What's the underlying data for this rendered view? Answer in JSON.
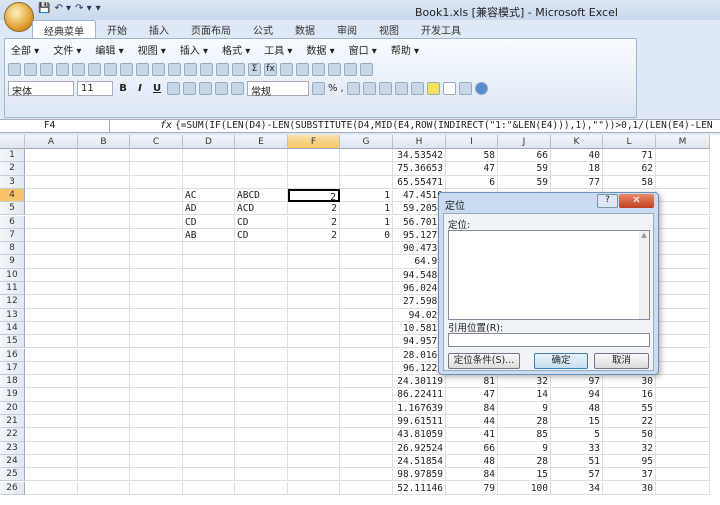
{
  "window": {
    "title": "Book1.xls  [兼容模式] - Microsoft Excel"
  },
  "qat": [
    "💾",
    "↶ ▾",
    "↷ ▾",
    "▾"
  ],
  "tabs": [
    "经典菜单",
    "开始",
    "插入",
    "页面布局",
    "公式",
    "数据",
    "审阅",
    "视图",
    "开发工具"
  ],
  "menus": [
    "全部 ▾",
    "文件 ▾",
    "编辑 ▾",
    "视图 ▾",
    "插入 ▾",
    "格式 ▾",
    "工具 ▾",
    "数据 ▾",
    "窗口 ▾",
    "帮助 ▾"
  ],
  "toolbar": {
    "font": "宋体",
    "size": "11",
    "bold": "B",
    "italic": "I",
    "underline": "U",
    "number_format": "常规",
    "percent": "%",
    "comma": ",",
    "sum": "Σ",
    "fx": "fx"
  },
  "formula_bar": {
    "name_box": "F4",
    "fx_label": "fx",
    "formula": "{=SUM(IF(LEN(D4)-LEN(SUBSTITUTE(D4,MID(E4,ROW(INDIRECT(\"1:\"&LEN(E4))),1),\"\"))>0,1/(LEN(E4)-LEN"
  },
  "columns": [
    "A",
    "B",
    "C",
    "D",
    "E",
    "F",
    "G",
    "H",
    "I",
    "J",
    "K",
    "L",
    "M"
  ],
  "active_cell": "F4",
  "rows": [
    [
      "",
      "",
      "",
      "",
      "",
      "",
      "",
      "34.53542",
      "58",
      "66",
      "40",
      "71",
      ""
    ],
    [
      "",
      "",
      "",
      "",
      "",
      "",
      "",
      "75.36653",
      "47",
      "59",
      "18",
      "62",
      ""
    ],
    [
      "",
      "",
      "",
      "",
      "",
      "",
      "",
      "65.55471",
      "6",
      "59",
      "77",
      "58",
      ""
    ],
    [
      "",
      "",
      "",
      "AC",
      "ABCD",
      "2",
      "1",
      "47.4510",
      "",
      "",
      "",
      "",
      ""
    ],
    [
      "",
      "",
      "",
      "AD",
      "ACD",
      "2",
      "1",
      "59.2054",
      "",
      "",
      "",
      "",
      ""
    ],
    [
      "",
      "",
      "",
      "CD",
      "CD",
      "2",
      "1",
      "56.7011",
      "",
      "",
      "",
      "",
      ""
    ],
    [
      "",
      "",
      "",
      "AB",
      "CD",
      "2",
      "0",
      "95.1279",
      "",
      "",
      "",
      "",
      ""
    ],
    [
      "",
      "",
      "",
      "",
      "",
      "",
      "",
      "90.4730",
      "",
      "",
      "",
      "",
      ""
    ],
    [
      "",
      "",
      "",
      "",
      "",
      "",
      "",
      "64.91",
      "",
      "",
      "",
      "",
      ""
    ],
    [
      "",
      "",
      "",
      "",
      "",
      "",
      "",
      "94.5488",
      "",
      "",
      "",
      "",
      ""
    ],
    [
      "",
      "",
      "",
      "",
      "",
      "",
      "",
      "96.0241",
      "",
      "",
      "",
      "",
      ""
    ],
    [
      "",
      "",
      "",
      "",
      "",
      "",
      "",
      "27.5983",
      "",
      "",
      "",
      "",
      ""
    ],
    [
      "",
      "",
      "",
      "",
      "",
      "",
      "",
      "94.029",
      "",
      "",
      "",
      "",
      ""
    ],
    [
      "",
      "",
      "",
      "",
      "",
      "",
      "",
      "10.5817",
      "",
      "",
      "",
      "",
      ""
    ],
    [
      "",
      "",
      "",
      "",
      "",
      "",
      "",
      "94.9572",
      "",
      "",
      "",
      "",
      ""
    ],
    [
      "",
      "",
      "",
      "",
      "",
      "",
      "",
      "28.0161",
      "",
      "",
      "",
      "",
      ""
    ],
    [
      "",
      "",
      "",
      "",
      "",
      "",
      "",
      "96.1221",
      "",
      "",
      "",
      "",
      ""
    ],
    [
      "",
      "",
      "",
      "",
      "",
      "",
      "",
      "24.30119",
      "81",
      "32",
      "97",
      "30",
      ""
    ],
    [
      "",
      "",
      "",
      "",
      "",
      "",
      "",
      "86.22411",
      "47",
      "14",
      "94",
      "16",
      ""
    ],
    [
      "",
      "",
      "",
      "",
      "",
      "",
      "",
      "1.167639",
      "84",
      "9",
      "48",
      "55",
      ""
    ],
    [
      "",
      "",
      "",
      "",
      "",
      "",
      "",
      "99.61511",
      "44",
      "28",
      "15",
      "22",
      ""
    ],
    [
      "",
      "",
      "",
      "",
      "",
      "",
      "",
      "43.81059",
      "41",
      "85",
      "5",
      "50",
      ""
    ],
    [
      "",
      "",
      "",
      "",
      "",
      "",
      "",
      "26.92524",
      "66",
      "9",
      "33",
      "32",
      ""
    ],
    [
      "",
      "",
      "",
      "",
      "",
      "",
      "",
      "24.51854",
      "48",
      "28",
      "51",
      "95",
      ""
    ],
    [
      "",
      "",
      "",
      "",
      "",
      "",
      "",
      "98.97859",
      "84",
      "15",
      "57",
      "37",
      ""
    ],
    [
      "",
      "",
      "",
      "",
      "",
      "",
      "",
      "52.11146",
      "79",
      "100",
      "34",
      "30",
      ""
    ]
  ],
  "dialog": {
    "title": "定位",
    "help": "?",
    "close": "✕",
    "goto_label": "定位:",
    "reference_label": "引用位置(R):",
    "reference_value": "",
    "special_button": "定位条件(S)...",
    "ok_button": "确定",
    "cancel_button": "取消"
  }
}
